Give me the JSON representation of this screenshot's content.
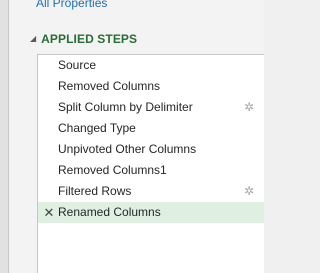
{
  "query_settings": {
    "all_properties_link": "All Properties",
    "applied_steps_title": "APPLIED STEPS",
    "collapse_glyph": "◢",
    "gear_glyph": "✲",
    "delete_glyph": "✕",
    "steps": [
      {
        "label": "Source",
        "has_settings": false,
        "selected": false
      },
      {
        "label": "Removed Columns",
        "has_settings": false,
        "selected": false
      },
      {
        "label": "Split Column by Delimiter",
        "has_settings": true,
        "selected": false
      },
      {
        "label": "Changed Type",
        "has_settings": false,
        "selected": false
      },
      {
        "label": "Unpivoted Other Columns",
        "has_settings": false,
        "selected": false
      },
      {
        "label": "Removed Columns1",
        "has_settings": false,
        "selected": false
      },
      {
        "label": "Filtered Rows",
        "has_settings": true,
        "selected": false
      },
      {
        "label": "Renamed Columns",
        "has_settings": false,
        "selected": true
      }
    ]
  },
  "colors": {
    "accent_green": "#2a6c36",
    "selection_bg": "#dff0e3",
    "link_blue": "#1e6fb3"
  }
}
